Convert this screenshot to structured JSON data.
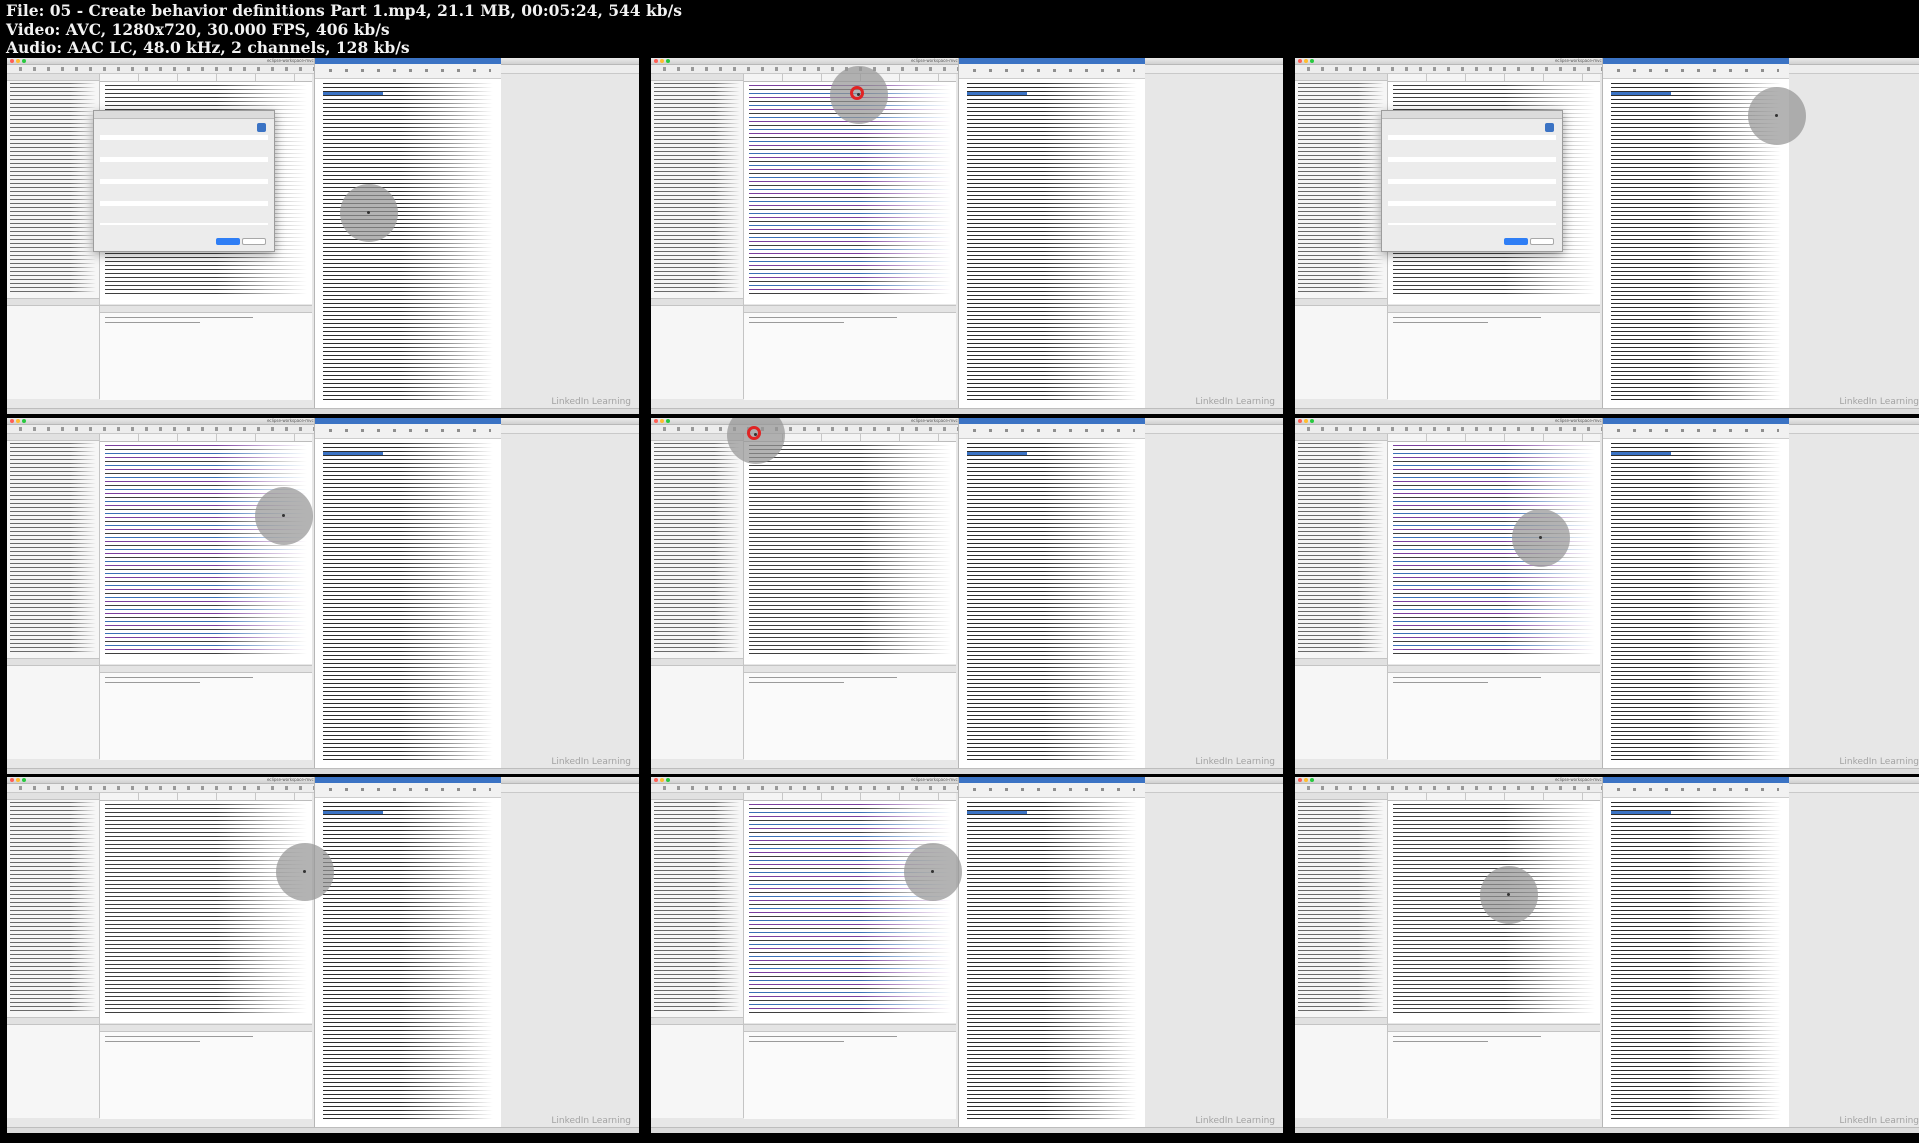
{
  "header": {
    "file_line": "File: 05 - Create behavior definitions Part 1.mp4, 21.1 MB, 00:05:24, 544 kb/s",
    "video_line": "Video: AVC, 1280x720, 30.000 FPS, 406 kb/s",
    "audio_line": "Audio: AAC LC, 48.0 kHz, 2 channels, 128 kb/s"
  },
  "thumbnails": [
    {
      "name": "thumbnail-1",
      "title": "eclipse-workspace-mvc01 - Data Definition - Eclipse IDE",
      "watermark": "LinkedIn Learning",
      "variant": "dialog"
    },
    {
      "name": "thumbnail-2",
      "title": "eclipse-workspace-mvc01 - Data Definition - Eclipse IDE",
      "watermark": "LinkedIn Learning",
      "variant": "code"
    },
    {
      "name": "thumbnail-3",
      "title": "eclipse-workspace-mvc01 - Data Definition - Eclipse IDE",
      "watermark": "LinkedIn Learning",
      "variant": "dialog"
    },
    {
      "name": "thumbnail-4",
      "title": "eclipse-workspace-mvc01 - Data Definition - Eclipse IDE",
      "watermark": "LinkedIn Learning",
      "variant": "code"
    },
    {
      "name": "thumbnail-5",
      "title": "eclipse-workspace-mvc01 - Data Definition - Eclipse IDE",
      "watermark": "LinkedIn Learning",
      "variant": "code"
    },
    {
      "name": "thumbnail-6",
      "title": "eclipse-workspace-mvc01 - Data Definition - Eclipse IDE",
      "watermark": "LinkedIn Learning",
      "variant": "code"
    },
    {
      "name": "thumbnail-7",
      "title": "eclipse-workspace-mvc01 - Data Definition - Eclipse IDE",
      "watermark": "LinkedIn Learning",
      "variant": "code"
    },
    {
      "name": "thumbnail-8",
      "title": "eclipse-workspace-mvc01 - Data Definition - Eclipse IDE",
      "watermark": "LinkedIn Learning",
      "variant": "code"
    },
    {
      "name": "thumbnail-9",
      "title": "eclipse-workspace-mvc01 - Data Definition - Eclipse IDE",
      "watermark": "LinkedIn Learning",
      "variant": "code"
    }
  ],
  "colors": {
    "background": "#000000",
    "header_text": "#f2f2f2",
    "ribbon_blue": "#3b73c4",
    "cursor_ring": "#969696",
    "click_red": "#e02424"
  }
}
